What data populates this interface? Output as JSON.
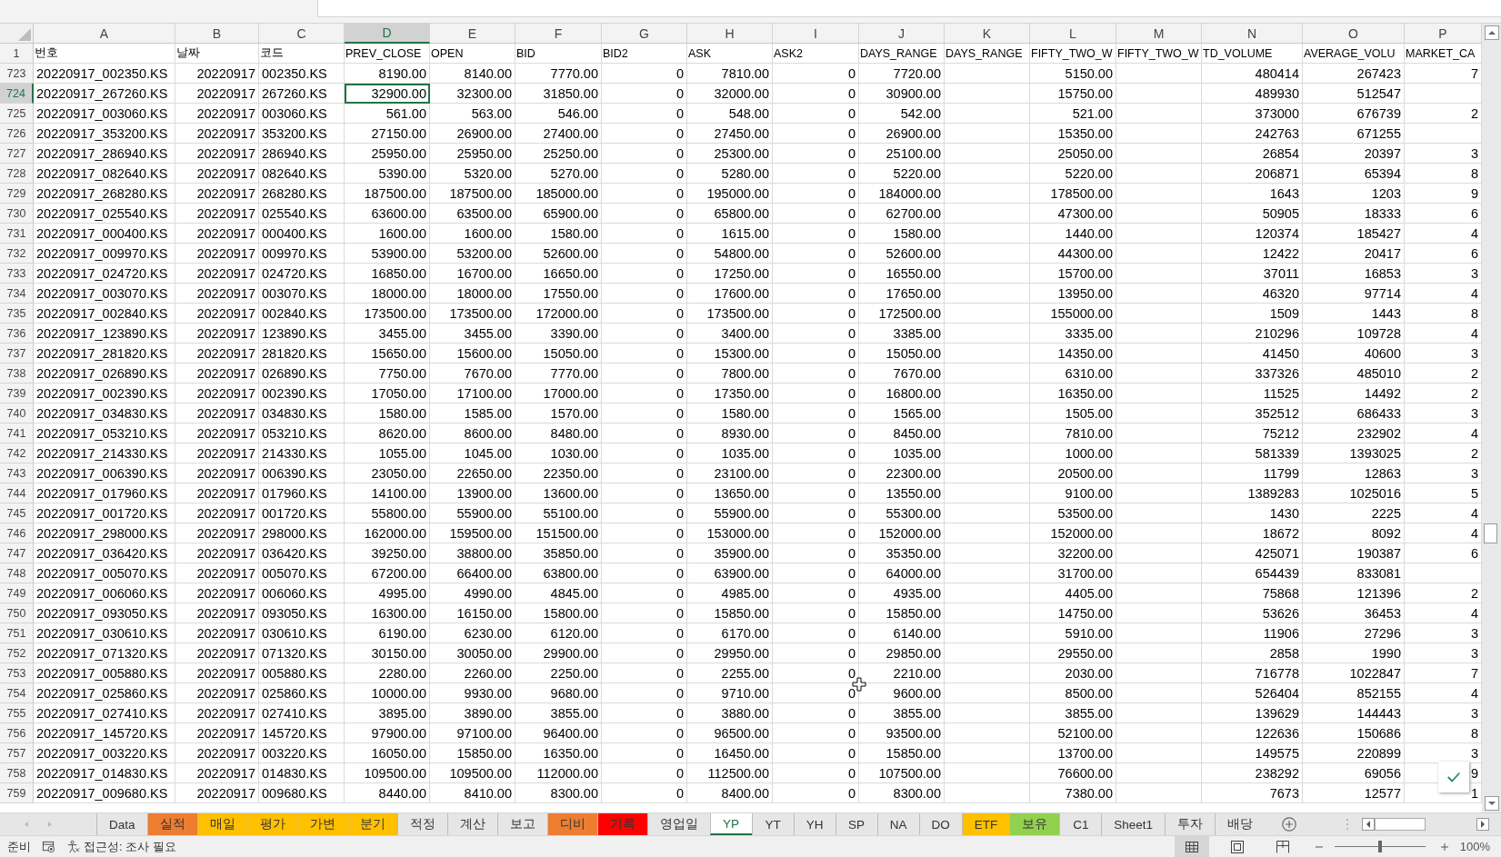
{
  "columns": [
    {
      "letter": "A",
      "heading": "번호",
      "kind": "text",
      "selected": false
    },
    {
      "letter": "B",
      "heading": "날짜",
      "kind": "number",
      "selected": false
    },
    {
      "letter": "C",
      "heading": "코드",
      "kind": "text",
      "selected": false
    },
    {
      "letter": "D",
      "heading": "PREV_CLOSE",
      "kind": "number",
      "selected": true
    },
    {
      "letter": "E",
      "heading": "OPEN",
      "kind": "number",
      "selected": false
    },
    {
      "letter": "F",
      "heading": "BID",
      "kind": "number",
      "selected": false
    },
    {
      "letter": "G",
      "heading": "BID2",
      "kind": "number",
      "selected": false
    },
    {
      "letter": "H",
      "heading": "ASK",
      "kind": "number",
      "selected": false
    },
    {
      "letter": "I",
      "heading": "ASK2",
      "kind": "number",
      "selected": false
    },
    {
      "letter": "J",
      "heading": "DAYS_RANGE",
      "kind": "number",
      "selected": false
    },
    {
      "letter": "K",
      "heading": "DAYS_RANGE",
      "selected": false
    },
    {
      "letter": "L",
      "heading": "FIFTY_TWO_W",
      "kind": "number",
      "selected": false
    },
    {
      "letter": "M",
      "heading": "FIFTY_TWO_W",
      "selected": false
    },
    {
      "letter": "N",
      "heading": "TD_VOLUME",
      "kind": "number",
      "selected": false
    },
    {
      "letter": "O",
      "heading": "AVERAGE_VOLU",
      "kind": "number",
      "selected": false
    },
    {
      "letter": "P",
      "heading": "MARKET_CA",
      "kind": "number",
      "selected": false
    }
  ],
  "header_row": "1",
  "rows": [
    {
      "row": "723",
      "selected": false,
      "cells": [
        "20220917_002350.KS",
        "20220917",
        "002350.KS",
        "8190.00",
        "8140.00",
        "7770.00",
        "0",
        "7810.00",
        "0",
        "7720.00",
        null,
        "5150.00",
        null,
        "480414",
        "267423",
        "7"
      ]
    },
    {
      "row": "724",
      "selected": true,
      "cells": [
        "20220917_267260.KS",
        "20220917",
        "267260.KS",
        "32900.00",
        "32300.00",
        "31850.00",
        "0",
        "32000.00",
        "0",
        "30900.00",
        null,
        "15750.00",
        null,
        "489930",
        "512547",
        null
      ]
    },
    {
      "row": "725",
      "selected": false,
      "cells": [
        "20220917_003060.KS",
        "20220917",
        "003060.KS",
        "561.00",
        "563.00",
        "546.00",
        "0",
        "548.00",
        "0",
        "542.00",
        null,
        "521.00",
        null,
        "373000",
        "676739",
        "2"
      ]
    },
    {
      "row": "726",
      "selected": false,
      "cells": [
        "20220917_353200.KS",
        "20220917",
        "353200.KS",
        "27150.00",
        "26900.00",
        "27400.00",
        "0",
        "27450.00",
        "0",
        "26900.00",
        null,
        "15350.00",
        null,
        "242763",
        "671255",
        null
      ]
    },
    {
      "row": "727",
      "selected": false,
      "cells": [
        "20220917_286940.KS",
        "20220917",
        "286940.KS",
        "25950.00",
        "25950.00",
        "25250.00",
        "0",
        "25300.00",
        "0",
        "25100.00",
        null,
        "25050.00",
        null,
        "26854",
        "20397",
        "3"
      ]
    },
    {
      "row": "728",
      "selected": false,
      "cells": [
        "20220917_082640.KS",
        "20220917",
        "082640.KS",
        "5390.00",
        "5320.00",
        "5270.00",
        "0",
        "5280.00",
        "0",
        "5220.00",
        null,
        "5220.00",
        null,
        "206871",
        "65394",
        "8"
      ]
    },
    {
      "row": "729",
      "selected": false,
      "cells": [
        "20220917_268280.KS",
        "20220917",
        "268280.KS",
        "187500.00",
        "187500.00",
        "185000.00",
        "0",
        "195000.00",
        "0",
        "184000.00",
        null,
        "178500.00",
        null,
        "1643",
        "1203",
        "9"
      ]
    },
    {
      "row": "730",
      "selected": false,
      "cells": [
        "20220917_025540.KS",
        "20220917",
        "025540.KS",
        "63600.00",
        "63500.00",
        "65900.00",
        "0",
        "65800.00",
        "0",
        "62700.00",
        null,
        "47300.00",
        null,
        "50905",
        "18333",
        "6"
      ]
    },
    {
      "row": "731",
      "selected": false,
      "cells": [
        "20220917_000400.KS",
        "20220917",
        "000400.KS",
        "1600.00",
        "1600.00",
        "1580.00",
        "0",
        "1615.00",
        "0",
        "1580.00",
        null,
        "1440.00",
        null,
        "120374",
        "185427",
        "4"
      ]
    },
    {
      "row": "732",
      "selected": false,
      "cells": [
        "20220917_009970.KS",
        "20220917",
        "009970.KS",
        "53900.00",
        "53200.00",
        "52600.00",
        "0",
        "54800.00",
        "0",
        "52600.00",
        null,
        "44300.00",
        null,
        "12422",
        "20417",
        "6"
      ]
    },
    {
      "row": "733",
      "selected": false,
      "cells": [
        "20220917_024720.KS",
        "20220917",
        "024720.KS",
        "16850.00",
        "16700.00",
        "16650.00",
        "0",
        "17250.00",
        "0",
        "16550.00",
        null,
        "15700.00",
        null,
        "37011",
        "16853",
        "3"
      ]
    },
    {
      "row": "734",
      "selected": false,
      "cells": [
        "20220917_003070.KS",
        "20220917",
        "003070.KS",
        "18000.00",
        "18000.00",
        "17550.00",
        "0",
        "17600.00",
        "0",
        "17650.00",
        null,
        "13950.00",
        null,
        "46320",
        "97714",
        "4"
      ]
    },
    {
      "row": "735",
      "selected": false,
      "cells": [
        "20220917_002840.KS",
        "20220917",
        "002840.KS",
        "173500.00",
        "173500.00",
        "172000.00",
        "0",
        "173500.00",
        "0",
        "172500.00",
        null,
        "155000.00",
        null,
        "1509",
        "1443",
        "8"
      ]
    },
    {
      "row": "736",
      "selected": false,
      "cells": [
        "20220917_123890.KS",
        "20220917",
        "123890.KS",
        "3455.00",
        "3455.00",
        "3390.00",
        "0",
        "3400.00",
        "0",
        "3385.00",
        null,
        "3335.00",
        null,
        "210296",
        "109728",
        "4"
      ]
    },
    {
      "row": "737",
      "selected": false,
      "cells": [
        "20220917_281820.KS",
        "20220917",
        "281820.KS",
        "15650.00",
        "15600.00",
        "15050.00",
        "0",
        "15300.00",
        "0",
        "15050.00",
        null,
        "14350.00",
        null,
        "41450",
        "40600",
        "3"
      ]
    },
    {
      "row": "738",
      "selected": false,
      "cells": [
        "20220917_026890.KS",
        "20220917",
        "026890.KS",
        "7750.00",
        "7670.00",
        "7770.00",
        "0",
        "7800.00",
        "0",
        "7670.00",
        null,
        "6310.00",
        null,
        "337326",
        "485010",
        "2"
      ]
    },
    {
      "row": "739",
      "selected": false,
      "cells": [
        "20220917_002390.KS",
        "20220917",
        "002390.KS",
        "17050.00",
        "17100.00",
        "17000.00",
        "0",
        "17350.00",
        "0",
        "16800.00",
        null,
        "16350.00",
        null,
        "11525",
        "14492",
        "2"
      ]
    },
    {
      "row": "740",
      "selected": false,
      "cells": [
        "20220917_034830.KS",
        "20220917",
        "034830.KS",
        "1580.00",
        "1585.00",
        "1570.00",
        "0",
        "1580.00",
        "0",
        "1565.00",
        null,
        "1505.00",
        null,
        "352512",
        "686433",
        "3"
      ]
    },
    {
      "row": "741",
      "selected": false,
      "cells": [
        "20220917_053210.KS",
        "20220917",
        "053210.KS",
        "8620.00",
        "8600.00",
        "8480.00",
        "0",
        "8930.00",
        "0",
        "8450.00",
        null,
        "7810.00",
        null,
        "75212",
        "232902",
        "4"
      ]
    },
    {
      "row": "742",
      "selected": false,
      "cells": [
        "20220917_214330.KS",
        "20220917",
        "214330.KS",
        "1055.00",
        "1045.00",
        "1030.00",
        "0",
        "1035.00",
        "0",
        "1035.00",
        null,
        "1000.00",
        null,
        "581339",
        "1393025",
        "2"
      ]
    },
    {
      "row": "743",
      "selected": false,
      "cells": [
        "20220917_006390.KS",
        "20220917",
        "006390.KS",
        "23050.00",
        "22650.00",
        "22350.00",
        "0",
        "23100.00",
        "0",
        "22300.00",
        null,
        "20500.00",
        null,
        "11799",
        "12863",
        "3"
      ]
    },
    {
      "row": "744",
      "selected": false,
      "cells": [
        "20220917_017960.KS",
        "20220917",
        "017960.KS",
        "14100.00",
        "13900.00",
        "13600.00",
        "0",
        "13650.00",
        "0",
        "13550.00",
        null,
        "9100.00",
        null,
        "1389283",
        "1025016",
        "5"
      ]
    },
    {
      "row": "745",
      "selected": false,
      "cells": [
        "20220917_001720.KS",
        "20220917",
        "001720.KS",
        "55800.00",
        "55900.00",
        "55100.00",
        "0",
        "55900.00",
        "0",
        "55300.00",
        null,
        "53500.00",
        null,
        "1430",
        "2225",
        "4"
      ]
    },
    {
      "row": "746",
      "selected": false,
      "cells": [
        "20220917_298000.KS",
        "20220917",
        "298000.KS",
        "162000.00",
        "159500.00",
        "151500.00",
        "0",
        "153000.00",
        "0",
        "152000.00",
        null,
        "152000.00",
        null,
        "18672",
        "8092",
        "4"
      ]
    },
    {
      "row": "747",
      "selected": false,
      "cells": [
        "20220917_036420.KS",
        "20220917",
        "036420.KS",
        "39250.00",
        "38800.00",
        "35850.00",
        "0",
        "35900.00",
        "0",
        "35350.00",
        null,
        "32200.00",
        null,
        "425071",
        "190387",
        "6"
      ]
    },
    {
      "row": "748",
      "selected": false,
      "cells": [
        "20220917_005070.KS",
        "20220917",
        "005070.KS",
        "67200.00",
        "66400.00",
        "63800.00",
        "0",
        "63900.00",
        "0",
        "64000.00",
        null,
        "31700.00",
        null,
        "654439",
        "833081",
        null
      ]
    },
    {
      "row": "749",
      "selected": false,
      "cells": [
        "20220917_006060.KS",
        "20220917",
        "006060.KS",
        "4995.00",
        "4990.00",
        "4845.00",
        "0",
        "4985.00",
        "0",
        "4935.00",
        null,
        "4405.00",
        null,
        "75868",
        "121396",
        "2"
      ]
    },
    {
      "row": "750",
      "selected": false,
      "cells": [
        "20220917_093050.KS",
        "20220917",
        "093050.KS",
        "16300.00",
        "16150.00",
        "15800.00",
        "0",
        "15850.00",
        "0",
        "15850.00",
        null,
        "14750.00",
        null,
        "53626",
        "36453",
        "4"
      ]
    },
    {
      "row": "751",
      "selected": false,
      "cells": [
        "20220917_030610.KS",
        "20220917",
        "030610.KS",
        "6190.00",
        "6230.00",
        "6120.00",
        "0",
        "6170.00",
        "0",
        "6140.00",
        null,
        "5910.00",
        null,
        "11906",
        "27296",
        "3"
      ]
    },
    {
      "row": "752",
      "selected": false,
      "cells": [
        "20220917_071320.KS",
        "20220917",
        "071320.KS",
        "30150.00",
        "30050.00",
        "29900.00",
        "0",
        "29950.00",
        "0",
        "29850.00",
        null,
        "29550.00",
        null,
        "2858",
        "1990",
        "3"
      ]
    },
    {
      "row": "753",
      "selected": false,
      "cells": [
        "20220917_005880.KS",
        "20220917",
        "005880.KS",
        "2280.00",
        "2260.00",
        "2250.00",
        "0",
        "2255.00",
        "0",
        "2210.00",
        null,
        "2030.00",
        null,
        "716778",
        "1022847",
        "7"
      ]
    },
    {
      "row": "754",
      "selected": false,
      "cells": [
        "20220917_025860.KS",
        "20220917",
        "025860.KS",
        "10000.00",
        "9930.00",
        "9680.00",
        "0",
        "9710.00",
        "0",
        "9600.00",
        null,
        "8500.00",
        null,
        "526404",
        "852155",
        "4"
      ]
    },
    {
      "row": "755",
      "selected": false,
      "cells": [
        "20220917_027410.KS",
        "20220917",
        "027410.KS",
        "3895.00",
        "3890.00",
        "3855.00",
        "0",
        "3880.00",
        "0",
        "3855.00",
        null,
        "3855.00",
        null,
        "139629",
        "144443",
        "3"
      ]
    },
    {
      "row": "756",
      "selected": false,
      "cells": [
        "20220917_145720.KS",
        "20220917",
        "145720.KS",
        "97900.00",
        "97100.00",
        "96400.00",
        "0",
        "96500.00",
        "0",
        "93500.00",
        null,
        "52100.00",
        null,
        "122636",
        "150686",
        "8"
      ]
    },
    {
      "row": "757",
      "selected": false,
      "cells": [
        "20220917_003220.KS",
        "20220917",
        "003220.KS",
        "16050.00",
        "15850.00",
        "16350.00",
        "0",
        "16450.00",
        "0",
        "15850.00",
        null,
        "13700.00",
        null,
        "149575",
        "220899",
        "3"
      ]
    },
    {
      "row": "758",
      "selected": false,
      "cells": [
        "20220917_014830.KS",
        "20220917",
        "014830.KS",
        "109500.00",
        "109500.00",
        "112000.00",
        "0",
        "112500.00",
        "0",
        "107500.00",
        null,
        "76600.00",
        null,
        "238292",
        "69056",
        "9"
      ]
    },
    {
      "row": "759",
      "selected": false,
      "cells": [
        "20220917_009680.KS",
        "20220917",
        "009680.KS",
        "8440.00",
        "8410.00",
        "8300.00",
        "0",
        "8400.00",
        "0",
        "8300.00",
        null,
        "7380.00",
        null,
        "7673",
        "12577",
        "1"
      ]
    }
  ],
  "sheet_tabs": [
    {
      "label": "Data",
      "selected": false
    },
    {
      "label": "실적",
      "selected": false,
      "color": "#ed7d31"
    },
    {
      "label": "매일",
      "selected": false,
      "color": "#ffc000"
    },
    {
      "label": "평가",
      "selected": false,
      "color": "#ffc000"
    },
    {
      "label": "가변",
      "selected": false,
      "color": "#ffc000"
    },
    {
      "label": "분기",
      "selected": false,
      "color": "#ffc000"
    },
    {
      "label": "적정",
      "selected": false
    },
    {
      "label": "계산",
      "selected": false
    },
    {
      "label": "보고",
      "selected": false
    },
    {
      "label": "디비",
      "selected": false,
      "color": "#ed7d31"
    },
    {
      "label": "기록",
      "selected": false,
      "color": "#ff0000"
    },
    {
      "label": "영업일",
      "selected": false
    },
    {
      "label": "YP",
      "selected": true
    },
    {
      "label": "YT",
      "selected": false
    },
    {
      "label": "YH",
      "selected": false
    },
    {
      "label": "SP",
      "selected": false
    },
    {
      "label": "NA",
      "selected": false
    },
    {
      "label": "DO",
      "selected": false
    },
    {
      "label": "ETF",
      "selected": false,
      "color": "#ffc000"
    },
    {
      "label": "보유",
      "selected": false,
      "color": "#92d050"
    },
    {
      "label": "C1",
      "selected": false
    },
    {
      "label": "Sheet1",
      "selected": false
    },
    {
      "label": "투자",
      "selected": false
    },
    {
      "label": "배당",
      "selected": false
    }
  ],
  "status_bar": {
    "mode": "준비",
    "accessibility": "접근성: 조사 필요",
    "view_modes": [
      {
        "kind": "normal",
        "selected": true
      },
      {
        "kind": "page_layout",
        "selected": false
      },
      {
        "kind": "page_break",
        "selected": false
      }
    ],
    "zoom": {
      "level": 0.5,
      "label": "100%"
    }
  }
}
